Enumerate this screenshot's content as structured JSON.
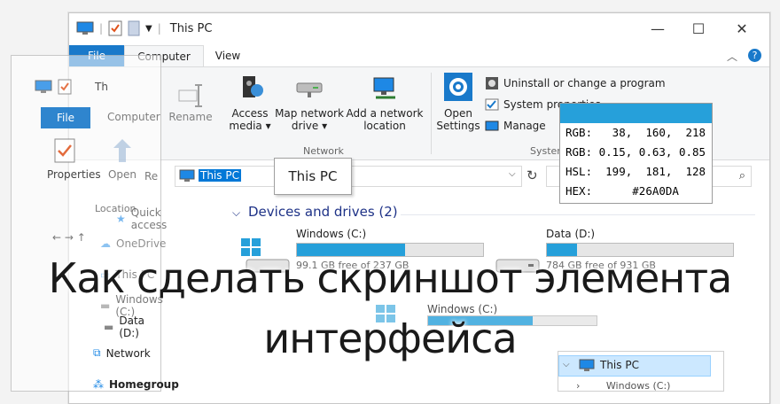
{
  "window": {
    "title": "This PC"
  },
  "ribbon_tabs": [
    {
      "label": "File"
    },
    {
      "label": "Computer"
    },
    {
      "label": "View"
    }
  ],
  "ribbon": {
    "buttons": [
      {
        "label": "Access\nmedia ▾"
      },
      {
        "label": "Map network\ndrive ▾"
      },
      {
        "label": "Add a network\nlocation"
      },
      {
        "label": "Open\nSettings"
      }
    ],
    "system_items": [
      {
        "label": "Uninstall or change a program"
      },
      {
        "label": "System properties"
      },
      {
        "label": "Manage"
      }
    ],
    "groups": [
      {
        "label": "Network"
      },
      {
        "label": "System"
      }
    ]
  },
  "address": {
    "path": "This PC"
  },
  "tooltip": {
    "text": "This PC"
  },
  "color_picker": {
    "swatch": "#26A0DA",
    "rows": [
      {
        "label": "RGB:",
        "value": "   38,  160,  218"
      },
      {
        "label": "RGB:",
        "value": " 0.15, 0.63, 0.85"
      },
      {
        "label": "HSL:",
        "value": "  199,  181,  128"
      },
      {
        "label": "HEX:",
        "value": "      #26A0DA"
      }
    ]
  },
  "section": {
    "title": "Devices and drives (2)"
  },
  "drives": [
    {
      "name": "Windows (C:)",
      "free": "99.1 GB free of 237 GB",
      "used_fraction": 0.58
    },
    {
      "name": "Data (D:)",
      "free": "784 GB free of 931 GB",
      "used_fraction": 0.16
    }
  ],
  "ghost_window": {
    "title": "Th",
    "tabs": [
      {
        "label": "File"
      },
      {
        "label": "Computer"
      }
    ],
    "buttons": [
      {
        "label": "Properties"
      },
      {
        "label": "Open"
      },
      {
        "label": "Re"
      },
      {
        "label": "Rename"
      }
    ],
    "group": "Location",
    "nav": [
      {
        "label": "Quick access"
      },
      {
        "label": "OneDrive"
      },
      {
        "label": "This PC"
      },
      {
        "label": "Windows (C:)"
      },
      {
        "label": "Data (D:)"
      },
      {
        "label": "Network"
      },
      {
        "label": "Homegroup"
      }
    ],
    "drive_name": "Windows (C:)"
  },
  "mini_tree": [
    {
      "label": "This PC"
    },
    {
      "label": "Windows (C:)"
    }
  ],
  "headline": {
    "line1": "Как сделать скриншот элемента",
    "line2": "интерфейса"
  },
  "colors": {
    "accent": "#26A0DA",
    "file_tab": "#1979ca",
    "link": "#1e3287"
  }
}
